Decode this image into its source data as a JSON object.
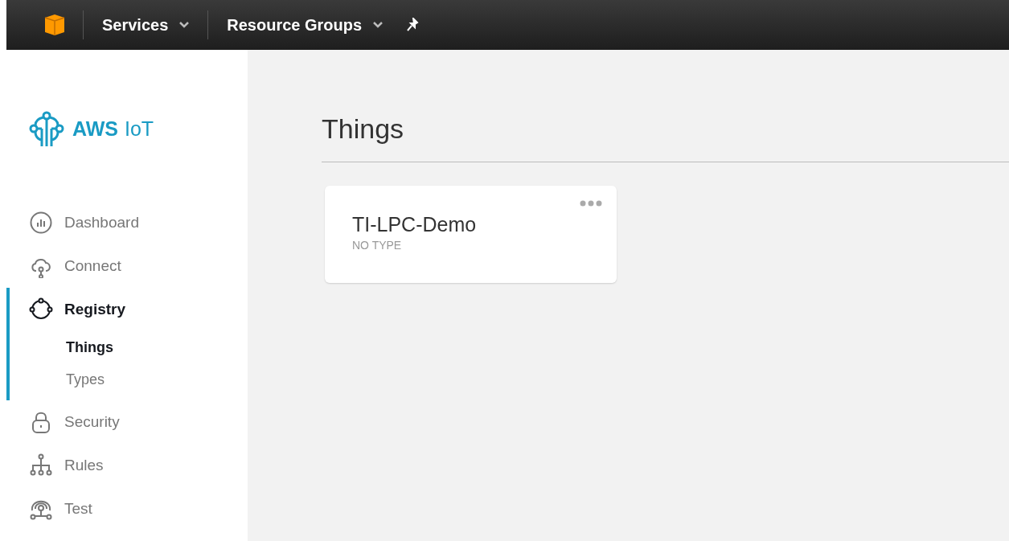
{
  "top_bar": {
    "menus": [
      {
        "label": "Services"
      },
      {
        "label": "Resource Groups"
      }
    ]
  },
  "sidebar": {
    "logo": {
      "bold": "AWS",
      "light": "IoT"
    },
    "items": [
      {
        "label": "Dashboard",
        "selected": false
      },
      {
        "label": "Connect",
        "selected": false
      },
      {
        "label": "Registry",
        "selected": true,
        "expanded": true,
        "children": [
          {
            "label": "Things",
            "selected": true
          },
          {
            "label": "Types",
            "selected": false
          }
        ]
      },
      {
        "label": "Security",
        "selected": false
      },
      {
        "label": "Rules",
        "selected": false
      },
      {
        "label": "Test",
        "selected": false
      }
    ]
  },
  "main": {
    "title": "Things",
    "cards": [
      {
        "name": "TI-LPC-Demo",
        "type": "NO TYPE"
      }
    ]
  }
}
